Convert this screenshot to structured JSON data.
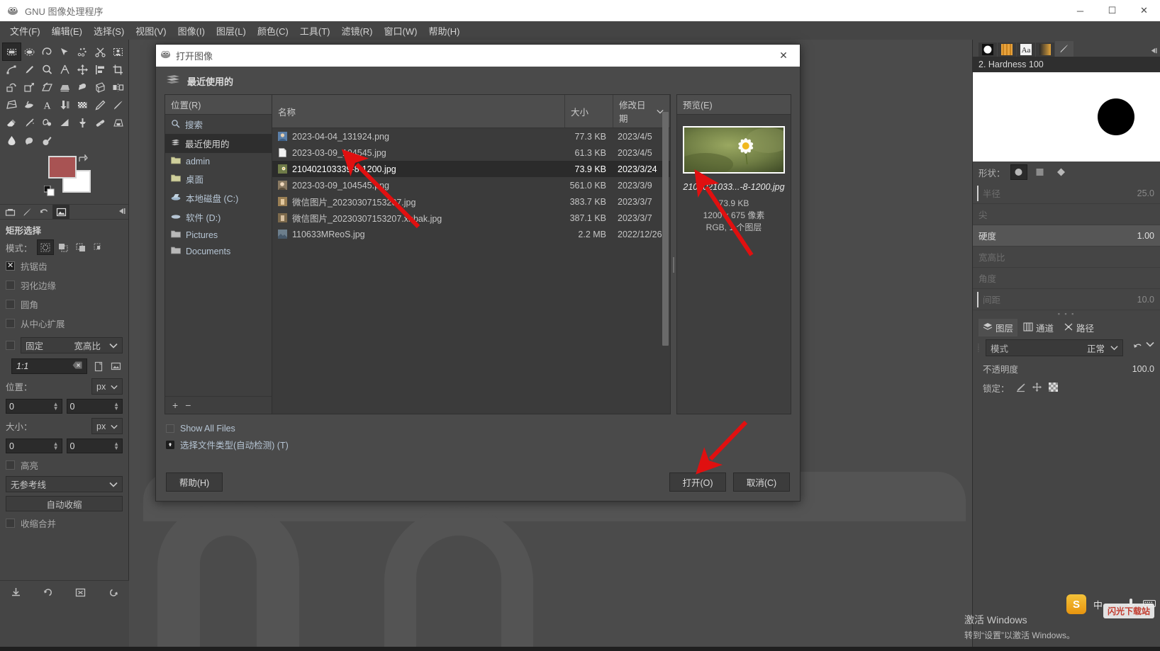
{
  "window": {
    "title": "GNU 图像处理程序",
    "app_icon": "gimp-wilber-icon",
    "minimize": "─",
    "maximize": "☐",
    "close": "✕"
  },
  "menubar": {
    "items": [
      {
        "label": "文件(F)",
        "name": "menu-file"
      },
      {
        "label": "编辑(E)",
        "name": "menu-edit"
      },
      {
        "label": "选择(S)",
        "name": "menu-select"
      },
      {
        "label": "视图(V)",
        "name": "menu-view"
      },
      {
        "label": "图像(I)",
        "name": "menu-image"
      },
      {
        "label": "图层(L)",
        "name": "menu-layer"
      },
      {
        "label": "颜色(C)",
        "name": "menu-colors"
      },
      {
        "label": "工具(T)",
        "name": "menu-tools"
      },
      {
        "label": "滤镜(R)",
        "name": "menu-filters"
      },
      {
        "label": "窗口(W)",
        "name": "menu-windows"
      },
      {
        "label": "帮助(H)",
        "name": "menu-help"
      }
    ]
  },
  "toolbox": {
    "tools": [
      "rect-select-icon",
      "ellipse-select-icon",
      "free-select-icon",
      "fuzzy-select-icon",
      "select-by-color-icon",
      "scissors-select-icon",
      "foreground-select-icon",
      "paths-icon",
      "color-picker-icon",
      "zoom-icon",
      "measure-icon",
      "move-icon",
      "alignment-icon",
      "crop-icon",
      "rotate-icon",
      "scale-icon",
      "shear-icon",
      "perspective-icon",
      "transform-3d-icon",
      "unified-transform-icon",
      "flip-icon",
      "warp-transform-icon",
      "bucket-fill-icon",
      "text-icon",
      "gradient-icon",
      "pattern-icon",
      "pencil-icon",
      "paintbrush-icon",
      "eraser-icon",
      "airbrush-icon",
      "ink-icon",
      "mypaint-brush-icon",
      "clone-icon",
      "heal-icon",
      "perspective-clone-icon",
      "blur-sharpen-icon",
      "smudge-icon",
      "dodge-burn-icon"
    ],
    "active_tool_index": 0,
    "foreground_color": "#a85353",
    "background_color": "#ffffff"
  },
  "tool_options": {
    "dock_tabs": [
      "tool-options-icon",
      "brushes-dock-icon",
      "undo-history-icon",
      "images-dock-icon"
    ],
    "active_dock_tab": 3,
    "title": "矩形选择",
    "mode_label": "模式：",
    "mode_buttons": [
      "replace-selection-icon",
      "add-selection-icon",
      "subtract-selection-icon",
      "intersect-selection-icon"
    ],
    "active_mode": 0,
    "checkboxes": [
      {
        "label": "抗锯齿",
        "checked": true,
        "name": "antialiasing-checkbox"
      },
      {
        "label": "羽化边缘",
        "checked": false,
        "name": "feather-edges-checkbox"
      },
      {
        "label": "圆角",
        "checked": false,
        "name": "rounded-corners-checkbox"
      },
      {
        "label": "从中心扩展",
        "checked": false,
        "name": "expand-from-center-checkbox"
      }
    ],
    "fixed": {
      "checked": false,
      "label": "固定",
      "value": "宽高比"
    },
    "ratio_value": "1:1",
    "position_label": "位置：",
    "position_unit": "px",
    "position_x": "0",
    "position_y": "0",
    "size_label": "大小：",
    "size_unit": "px",
    "size_w": "0",
    "size_h": "0",
    "highlight": {
      "label": "高亮",
      "checked": false
    },
    "guides": "无参考线",
    "auto_shrink": "自动收缩",
    "shrink_merged": {
      "label": "收缩合并",
      "checked": false
    }
  },
  "right_dock": {
    "tabs": [
      "brushes-tab-icon",
      "patterns-tab-icon",
      "fonts-tab-icon",
      "gradients-tab-icon",
      "paint-dynamics-tab-icon"
    ],
    "active_tab": 4,
    "brush_name": "2. Hardness 100",
    "shape_label": "形状：",
    "shapes": [
      "circle-shape-icon",
      "square-shape-icon",
      "diamond-shape-icon"
    ],
    "active_shape": 0,
    "sliders": [
      {
        "label": "半径",
        "value": "25.0",
        "highlighted": false,
        "name": "radius-slider"
      },
      {
        "label": "尖",
        "value": "",
        "highlighted": false,
        "name": "spikes-slider"
      },
      {
        "label": "硬度",
        "value": "1.00",
        "highlighted": true,
        "name": "hardness-slider"
      },
      {
        "label": "宽高比",
        "value": "",
        "highlighted": false,
        "name": "aspect-ratio-slider"
      },
      {
        "label": "角度",
        "value": "",
        "highlighted": false,
        "name": "angle-slider"
      },
      {
        "label": "间距",
        "value": "10.0",
        "highlighted": false,
        "name": "spacing-slider"
      }
    ],
    "layer_tabs": [
      {
        "label": "图层",
        "icon": "layers-tab-icon",
        "active": true
      },
      {
        "label": "通道",
        "icon": "channels-tab-icon",
        "active": false
      },
      {
        "label": "路径",
        "icon": "paths-tab-icon",
        "active": false
      }
    ],
    "mode_label": "模式",
    "mode_value": "正常",
    "opacity_label": "不透明度",
    "opacity_value": "100.0",
    "lock_label": "锁定：",
    "lock_icons": [
      "lock-pixels-icon",
      "lock-position-icon",
      "lock-alpha-icon"
    ]
  },
  "dialog": {
    "title": "打开图像",
    "title_icon": "gimp-wilber-icon",
    "close_icon": "✕",
    "breadcrumb_icon": "recent-icon",
    "breadcrumb": "最近使用的",
    "places_header": "位置(R)",
    "places": [
      {
        "label": "搜索",
        "icon": "search-icon",
        "active": false
      },
      {
        "label": "最近使用的",
        "icon": "recent-icon",
        "active": true
      },
      {
        "label": "admin",
        "icon": "folder-icon",
        "active": false
      },
      {
        "label": "桌面",
        "icon": "folder-icon",
        "active": false
      },
      {
        "label": "本地磁盘 (C:)",
        "icon": "drive-icon",
        "active": false
      },
      {
        "label": "软件 (D:)",
        "icon": "drive-icon",
        "active": false
      },
      {
        "label": "Pictures",
        "icon": "folder-icon",
        "active": false
      },
      {
        "label": "Documents",
        "icon": "folder-icon",
        "active": false
      }
    ],
    "places_add": "+",
    "places_remove": "−",
    "columns": {
      "name": "名称",
      "size": "大小",
      "date": "修改日期",
      "sort_caret": "∨"
    },
    "files": [
      {
        "name": "2023-04-04_131924.png",
        "size": "77.3 KB",
        "date": "2023/4/5",
        "selected": false,
        "thumb": "#5b7fa8"
      },
      {
        "name": "2023-03-09_104545.jpg",
        "size": "61.3 KB",
        "date": "2023/4/5",
        "selected": false,
        "thumb": "#ededed"
      },
      {
        "name": "210402103339-8-1200.jpg",
        "size": "73.9 KB",
        "date": "2023/3/24",
        "selected": true,
        "thumb": "#6f7b48"
      },
      {
        "name": "2023-03-09_104545.png",
        "size": "561.0 KB",
        "date": "2023/3/9",
        "selected": false,
        "thumb": "#8a7a62"
      },
      {
        "name": "微信图片_20230307153207.jpg",
        "size": "383.7 KB",
        "date": "2023/3/7",
        "selected": false,
        "thumb": "#9a7f54"
      },
      {
        "name": "微信图片_20230307153207.xnbak.jpg",
        "size": "387.1 KB",
        "date": "2023/3/7",
        "selected": false,
        "thumb": "#7d6a4c"
      },
      {
        "name": "110633MReoS.jpg",
        "size": "2.2 MB",
        "date": "2022/12/26",
        "selected": false,
        "thumb": "#6c7e8c"
      }
    ],
    "preview_header": "预览(E)",
    "preview_name": "2104021033...-8-1200.jpg",
    "preview_size": "73.9 KB",
    "preview_dimensions": "1200 x 675 像素",
    "preview_mode": "RGB, 1 个图层",
    "show_all_files": {
      "label": "Show All Files",
      "checked": false
    },
    "file_type": {
      "label": "选择文件类型(自动检测) (T)",
      "expanded": false
    },
    "buttons": {
      "help": "帮助(H)",
      "open": "打开(O)",
      "cancel": "取消(C)"
    }
  },
  "overlay": {
    "ime": {
      "badge": "S",
      "lang": "中",
      "punct": "，",
      "mic": "mic-icon",
      "keyboard": "keyboard-icon"
    },
    "watermark": "闪光下载站",
    "activate_line1": "激活 Windows",
    "activate_line2": "转到“设置”以激活 Windows。"
  },
  "colors": {
    "accent_red": "#e01010",
    "panel_bg": "#454545",
    "dialog_bg": "#4a4a4a",
    "canvas_bg": "#4b4b4b",
    "link_blue": "#b6c5d4"
  }
}
